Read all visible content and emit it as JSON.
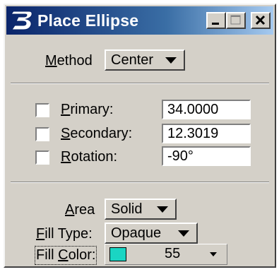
{
  "window": {
    "title": "Place Ellipse",
    "icon": "bentley-b-icon",
    "buttons": [
      "minimize-icon",
      "maximize-icon",
      "close-icon"
    ]
  },
  "method": {
    "label": "Method",
    "value": "Center"
  },
  "fields": [
    {
      "label": "Primary:",
      "value": "34.0000",
      "checked": false
    },
    {
      "label": "Secondary:",
      "value": "12.3019",
      "checked": false
    },
    {
      "label": "Rotation:",
      "value": "-90°",
      "checked": false
    }
  ],
  "area": {
    "label": "Area",
    "value": "Solid"
  },
  "fill_type": {
    "label": "Fill Type:",
    "value": "Opaque"
  },
  "fill_color": {
    "label": "Fill Color:",
    "value": "55",
    "swatch": "#1ad5c3"
  },
  "colors": {
    "titlebar_start": "#0a246a",
    "titlebar_end": "#a6caf0",
    "face": "#d4d0c8"
  }
}
